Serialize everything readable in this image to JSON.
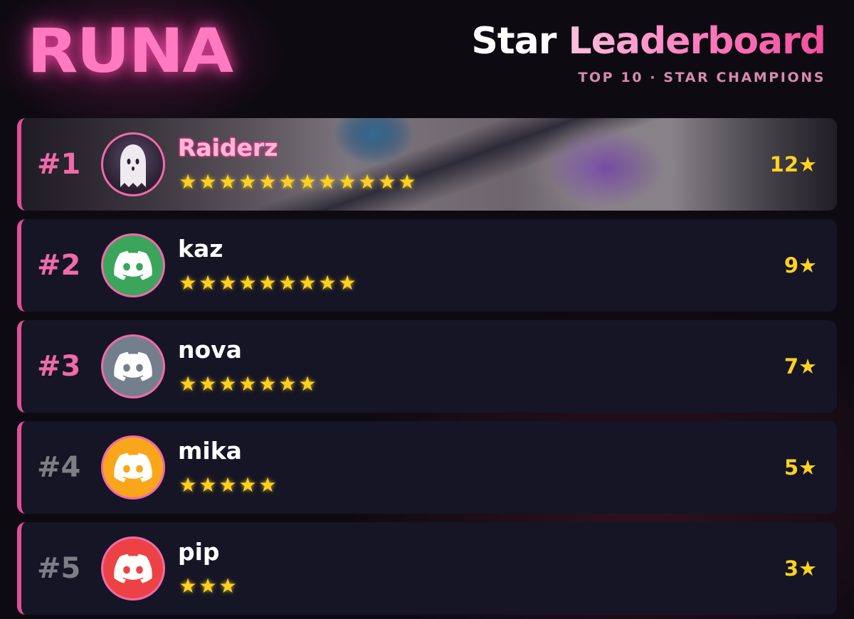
{
  "header": {
    "brand": "RUNA",
    "title_part1": "Star",
    "title_part2": "Leaderboard",
    "subtitle": "TOP 10 · STAR CHAMPIONS"
  },
  "colors": {
    "accent_pink": "#f06aaa",
    "star_gold": "#ffd21f",
    "row_bg": "#151526"
  },
  "entries": [
    {
      "rank": "#1",
      "name": "Raiderz",
      "stars": 12,
      "count": "12★",
      "avatar": "ghost-icon"
    },
    {
      "rank": "#2",
      "name": "kaz",
      "stars": 9,
      "count": "9★",
      "avatar": "discord-icon",
      "avatar_color": "#3ba55c"
    },
    {
      "rank": "#3",
      "name": "nova",
      "stars": 7,
      "count": "7★",
      "avatar": "discord-icon",
      "avatar_color": "#747f8d"
    },
    {
      "rank": "#4",
      "name": "mika",
      "stars": 5,
      "count": "5★",
      "avatar": "discord-icon",
      "avatar_color": "#faa61a"
    },
    {
      "rank": "#5",
      "name": "pip",
      "stars": 3,
      "count": "3★",
      "avatar": "discord-icon",
      "avatar_color": "#ed4245"
    }
  ]
}
